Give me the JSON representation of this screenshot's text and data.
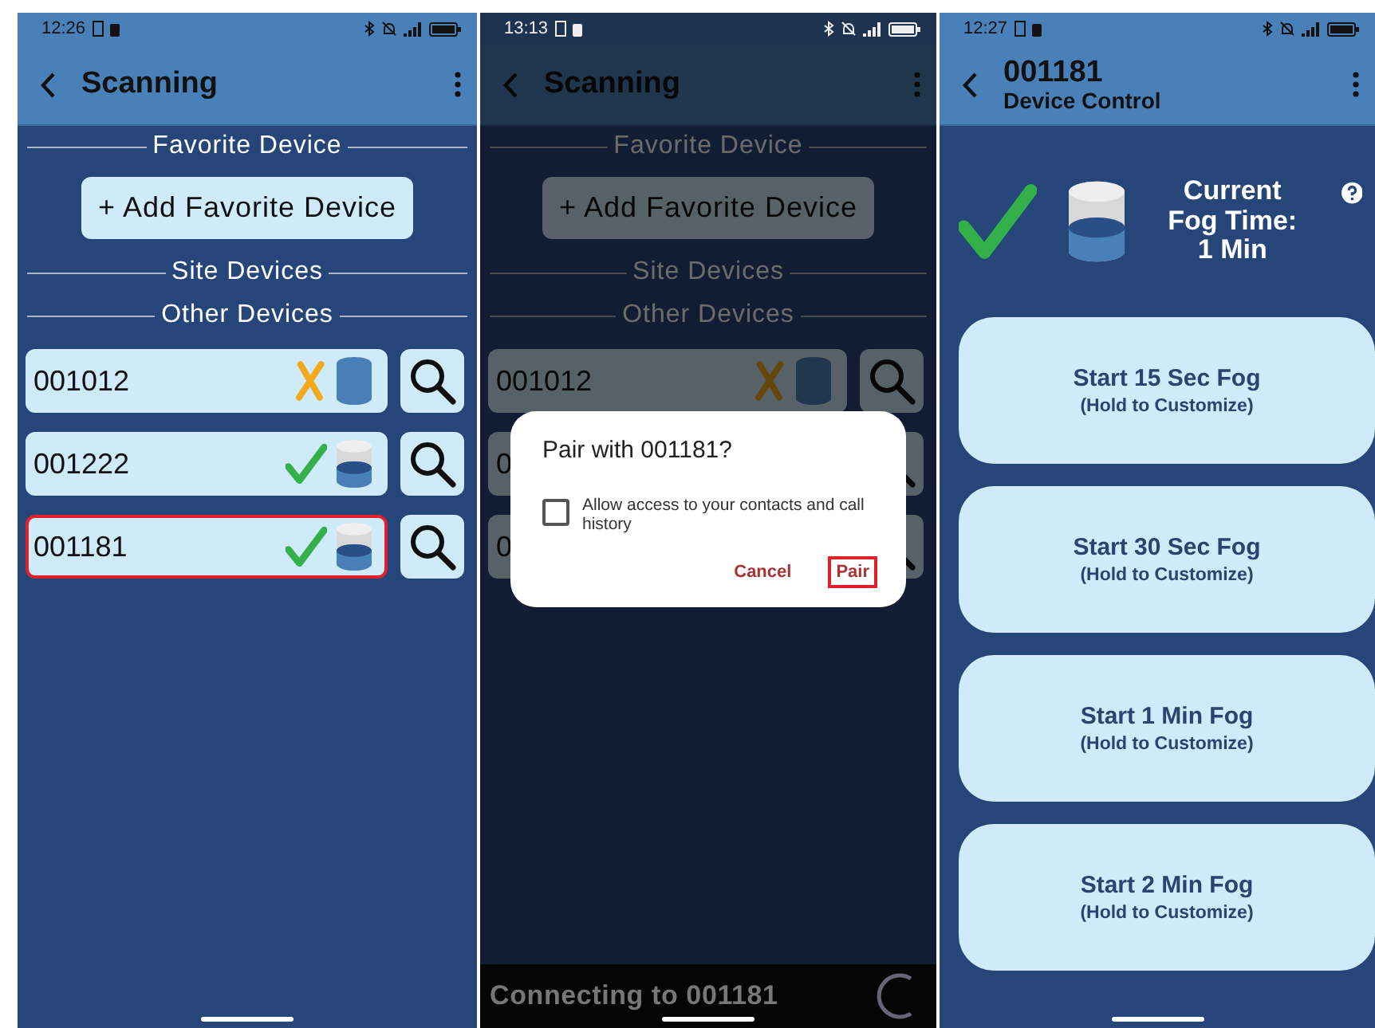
{
  "screens": [
    {
      "kind": "scan",
      "status_time": "12:26",
      "dimmed": false,
      "title": "Scanning",
      "favorite_heading": "Favorite Device",
      "add_button": "+ Add Favorite Device",
      "site_heading": "Site Devices",
      "other_heading": "Other Devices",
      "devices": [
        {
          "id": "001012",
          "connected": false,
          "level": 1,
          "selected": false
        },
        {
          "id": "001222",
          "connected": true,
          "level": 0.55,
          "selected": false
        },
        {
          "id": "001181",
          "connected": true,
          "level": 0.55,
          "selected": true
        }
      ]
    },
    {
      "kind": "scan",
      "status_time": "13:13",
      "dimmed": true,
      "title": "Scanning",
      "favorite_heading": "Favorite Device",
      "add_button": "+ Add Favorite Device",
      "site_heading": "Site Devices",
      "other_heading": "Other Devices",
      "devices": [
        {
          "id": "001012",
          "connected": false,
          "level": 1,
          "selected": false
        },
        {
          "id": "0",
          "selected": false
        },
        {
          "id": "0",
          "selected": false
        }
      ],
      "dialog": {
        "title": "Pair with 001181?",
        "checkbox_label": "Allow access to your contacts and call history",
        "checked": false,
        "buttons": [
          {
            "label": "Cancel",
            "highlighted": false
          },
          {
            "label": "Pair",
            "highlighted": true
          }
        ]
      },
      "snackbar": {
        "text": "Connecting to 001181"
      }
    },
    {
      "kind": "control",
      "status_time": "12:27",
      "title": "001181",
      "subtitle": "Device Control",
      "connected": true,
      "level": 0.55,
      "fog_label": "Current Fog Time:",
      "fog_time": "1 Min",
      "buttons": [
        {
          "title": "Start 15 Sec Fog",
          "hint": "(Hold to Customize)"
        },
        {
          "title": "Start 30 Sec Fog",
          "hint": "(Hold to Customize)"
        },
        {
          "title": "Start 1 Min Fog",
          "hint": "(Hold to Customize)"
        },
        {
          "title": "Start 2 Min Fog",
          "hint": "(Hold to Customize)"
        }
      ]
    }
  ]
}
